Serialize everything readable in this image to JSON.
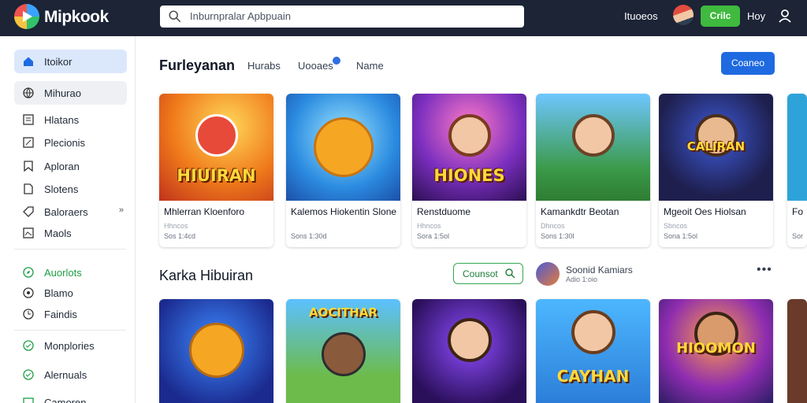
{
  "topbar": {
    "app_name": "Mipkook",
    "search_placeholder": "Inburnpralar Apbpuain",
    "link": "Ituoeos",
    "button": "Crilc",
    "link2": "Hoy"
  },
  "sidebar": {
    "items": [
      {
        "label": "Itoikor",
        "icon": "home-icon"
      },
      {
        "label": "Mihurao",
        "icon": "globe-icon"
      },
      {
        "label": "Hlatans",
        "icon": "grid-icon"
      },
      {
        "label": "Plecionis",
        "icon": "edit-icon"
      },
      {
        "label": "Aploran",
        "icon": "bookmark-icon"
      },
      {
        "label": "Slotens",
        "icon": "document-icon"
      },
      {
        "label": "Baloraers",
        "icon": "tag-icon",
        "suffix": "»"
      },
      {
        "label": "Maols",
        "icon": "image-icon"
      }
    ],
    "section2": [
      {
        "label": "Auorlots",
        "icon": "compass-icon"
      },
      {
        "label": "Blamo",
        "icon": "circle-icon"
      },
      {
        "label": "Faindis",
        "icon": "clock-icon"
      },
      {
        "label": "Monplories",
        "icon": "shield-icon"
      },
      {
        "label": "Alernuals",
        "icon": "shield-icon"
      },
      {
        "label": "Camoren",
        "icon": "box-icon"
      }
    ]
  },
  "main": {
    "title": "Furleyanan",
    "tabs": [
      "Hurabs",
      "Uooaes",
      "Name"
    ],
    "primary_button": "Coaneo",
    "cards": [
      {
        "art_word": "HIUIRAN",
        "name": "Mhlerran Kloenforo",
        "meta": "Hhncos",
        "sub": "Sos 1:4cd"
      },
      {
        "art_word": "",
        "name": "Kalemos Hiokentin Slone",
        "meta": "",
        "sub": "Sons 1:30d"
      },
      {
        "art_word": "HIONES",
        "name": "Renstduome",
        "meta": "Hhncos",
        "sub": "Sora 1:5ol"
      },
      {
        "art_word": "",
        "name": "Kamankdtr Beotan",
        "meta": "Dhncos",
        "sub": "Sons 1:30l"
      },
      {
        "art_word": "CALIRAN",
        "name": "Mgeoit Oes Hiolsan",
        "meta": "Sbncos",
        "sub": "Sona 1:5ol"
      },
      {
        "art_word": "",
        "name": "Fo",
        "meta": "",
        "sub": "Sor"
      }
    ],
    "section2_title": "Karka Hibuiran",
    "outline_button": "Counsot",
    "mini_name": "Soonid Kamiars",
    "mini_sub": "Adio 1:oio",
    "more": "•••",
    "cards2": [
      {
        "word": ""
      },
      {
        "word": "AOCITHAR"
      },
      {
        "word": ""
      },
      {
        "word": "CAYHAN"
      },
      {
        "word": "HIOOMON"
      },
      {
        "word": ""
      }
    ]
  }
}
